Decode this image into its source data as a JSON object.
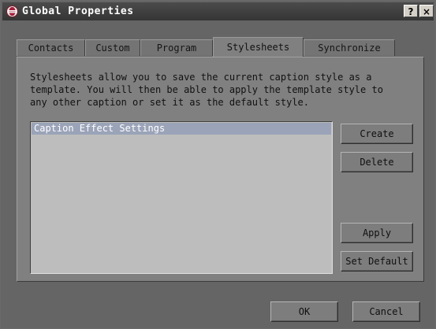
{
  "window": {
    "title": "Global Properties",
    "help_button": "?",
    "close_button": "×"
  },
  "tabs": [
    {
      "label": "Contacts",
      "active": false
    },
    {
      "label": "Custom",
      "active": false
    },
    {
      "label": "Program",
      "active": false
    },
    {
      "label": "Stylesheets",
      "active": true
    },
    {
      "label": "Synchronize",
      "active": false
    }
  ],
  "stylesheets": {
    "description": "Stylesheets allow you to save the current caption style as a\ntemplate.  You will then be able to apply the template style to\nany other caption or set it as the default style.",
    "list_items": [
      "Caption Effect Settings"
    ],
    "selected_index": 0,
    "create_label": "Create",
    "delete_label": "Delete",
    "apply_label": "Apply",
    "set_default_label": "Set Default"
  },
  "footer": {
    "ok_label": "OK",
    "cancel_label": "Cancel"
  },
  "colors": {
    "titlebar": "#3f3f3f",
    "panel": "#808080",
    "selection": "#9aa3b8"
  }
}
